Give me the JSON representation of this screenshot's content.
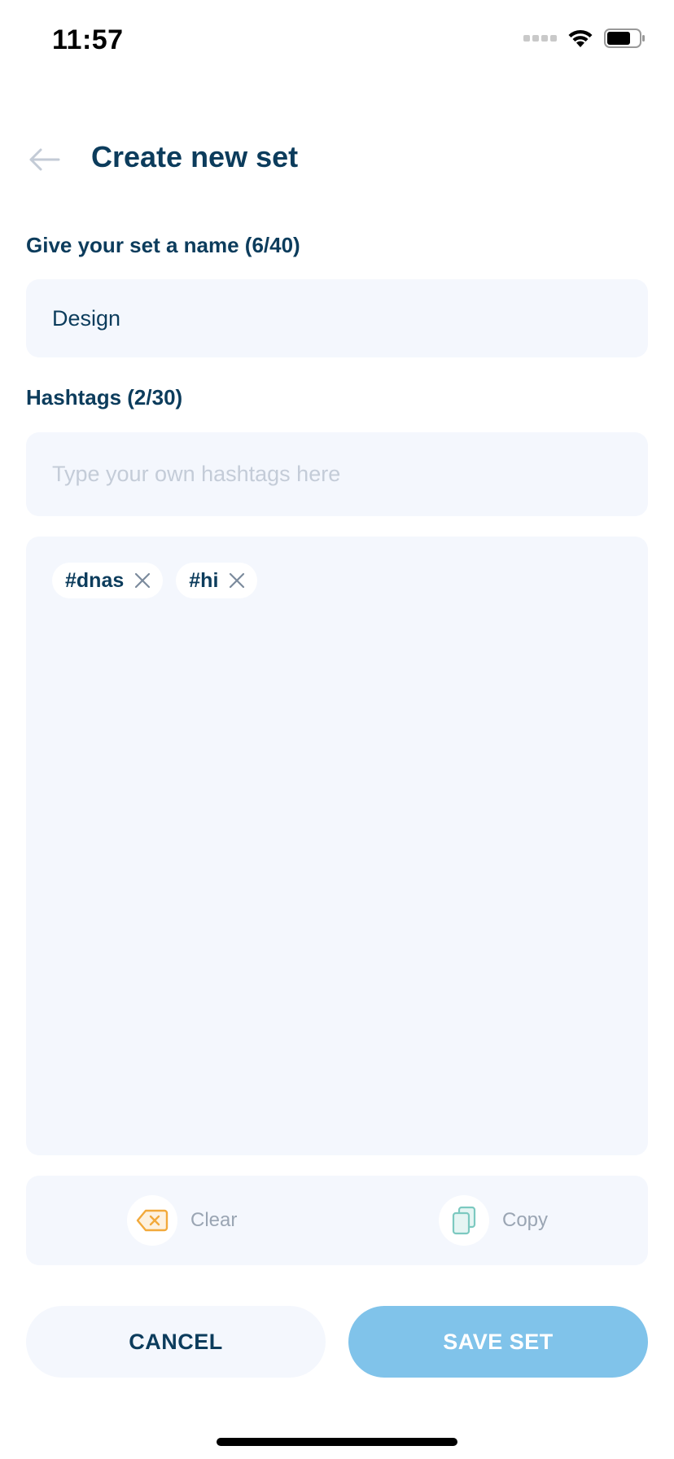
{
  "status_bar": {
    "time": "11:57"
  },
  "header": {
    "title": "Create new set",
    "back_icon": "arrow-left-icon"
  },
  "name_section": {
    "label": "Give your set a name (6/40)",
    "value": "Design"
  },
  "hashtags_section": {
    "label": "Hashtags (2/30)",
    "input_placeholder": "Type your own hashtags here",
    "input_value": "",
    "tags": [
      {
        "text": "#dnas"
      },
      {
        "text": "#hi"
      }
    ]
  },
  "actions": {
    "clear": {
      "label": "Clear",
      "icon": "backspace-icon",
      "color": "#f2a93b"
    },
    "copy": {
      "label": "Copy",
      "icon": "copy-icon",
      "color": "#7cc9c0"
    }
  },
  "buttons": {
    "cancel_label": "CANCEL",
    "save_label": "SAVE SET"
  },
  "colors": {
    "primary_text": "#0c3c5c",
    "field_bg": "#f4f7fd",
    "save_button": "#80c3ea",
    "muted_text": "#9aa5b3"
  }
}
